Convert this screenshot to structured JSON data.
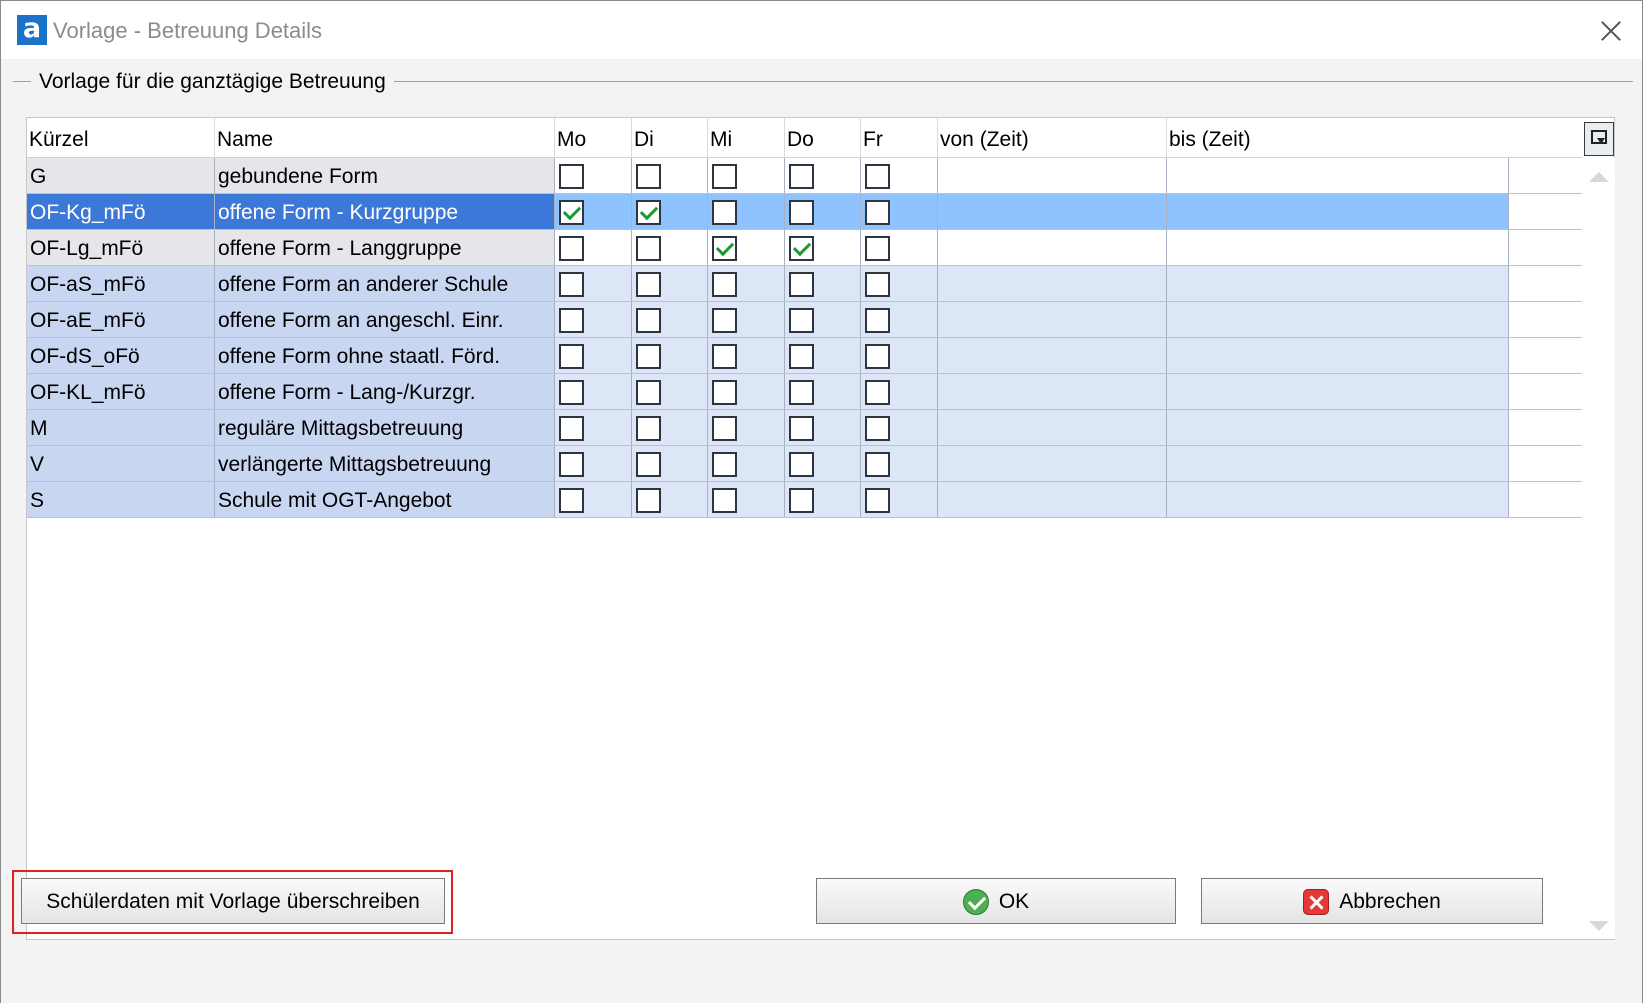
{
  "window": {
    "title": "Vorlage - Betreuung Details",
    "logo_letter": "a"
  },
  "group": {
    "title": "Vorlage für die ganztägige Betreuung"
  },
  "grid": {
    "columns": [
      "Kürzel",
      "Name",
      "Mo",
      "Di",
      "Mi",
      "Do",
      "Fr",
      "von (Zeit)",
      "bis (Zeit)"
    ],
    "rows": [
      {
        "kuerzel": "G",
        "name": "gebundene Form",
        "mo": false,
        "di": false,
        "mi": false,
        "do": false,
        "fr": false,
        "von": "",
        "bis": "",
        "selected": false
      },
      {
        "kuerzel": "OF-Kg_mFö",
        "name": "offene Form - Kurzgruppe",
        "mo": true,
        "di": true,
        "mi": false,
        "do": false,
        "fr": false,
        "von": "",
        "bis": "",
        "selected": true
      },
      {
        "kuerzel": "OF-Lg_mFö",
        "name": "offene Form - Langgruppe",
        "mo": false,
        "di": false,
        "mi": true,
        "do": true,
        "fr": false,
        "von": "",
        "bis": "",
        "selected": false
      },
      {
        "kuerzel": "OF-aS_mFö",
        "name": "offene Form an anderer Schule",
        "mo": false,
        "di": false,
        "mi": false,
        "do": false,
        "fr": false,
        "von": "",
        "bis": "",
        "selected": false
      },
      {
        "kuerzel": "OF-aE_mFö",
        "name": "offene Form an angeschl. Einr.",
        "mo": false,
        "di": false,
        "mi": false,
        "do": false,
        "fr": false,
        "von": "",
        "bis": "",
        "selected": false
      },
      {
        "kuerzel": "OF-dS_oFö",
        "name": "offene Form ohne staatl. Förd.",
        "mo": false,
        "di": false,
        "mi": false,
        "do": false,
        "fr": false,
        "von": "",
        "bis": "",
        "selected": false
      },
      {
        "kuerzel": "OF-KL_mFö",
        "name": "offene Form - Lang-/Kurzgr.",
        "mo": false,
        "di": false,
        "mi": false,
        "do": false,
        "fr": false,
        "von": "",
        "bis": "",
        "selected": false
      },
      {
        "kuerzel": "M",
        "name": "reguläre Mittagsbetreuung",
        "mo": false,
        "di": false,
        "mi": false,
        "do": false,
        "fr": false,
        "von": "",
        "bis": "",
        "selected": false
      },
      {
        "kuerzel": "V",
        "name": "verlängerte Mittagsbetreuung",
        "mo": false,
        "di": false,
        "mi": false,
        "do": false,
        "fr": false,
        "von": "",
        "bis": "",
        "selected": false
      },
      {
        "kuerzel": "S",
        "name": "Schule mit OGT-Angebot",
        "mo": false,
        "di": false,
        "mi": false,
        "do": false,
        "fr": false,
        "von": "",
        "bis": "",
        "selected": false
      }
    ]
  },
  "buttons": {
    "overwrite": "Schülerdaten mit Vorlage überschreiben",
    "ok": "OK",
    "cancel": "Abbrechen"
  },
  "icons": {
    "logo": "app-logo-icon",
    "close": "close-icon",
    "column_chooser": "column-chooser-icon",
    "ok": "ok-check-icon",
    "cancel": "cancel-x-icon"
  },
  "colors": {
    "selection_row_left": "#3b78d8",
    "selection_row_right": "#8fc3ff",
    "highlight_frame": "#e02020",
    "check_green": "#1a9a32"
  }
}
